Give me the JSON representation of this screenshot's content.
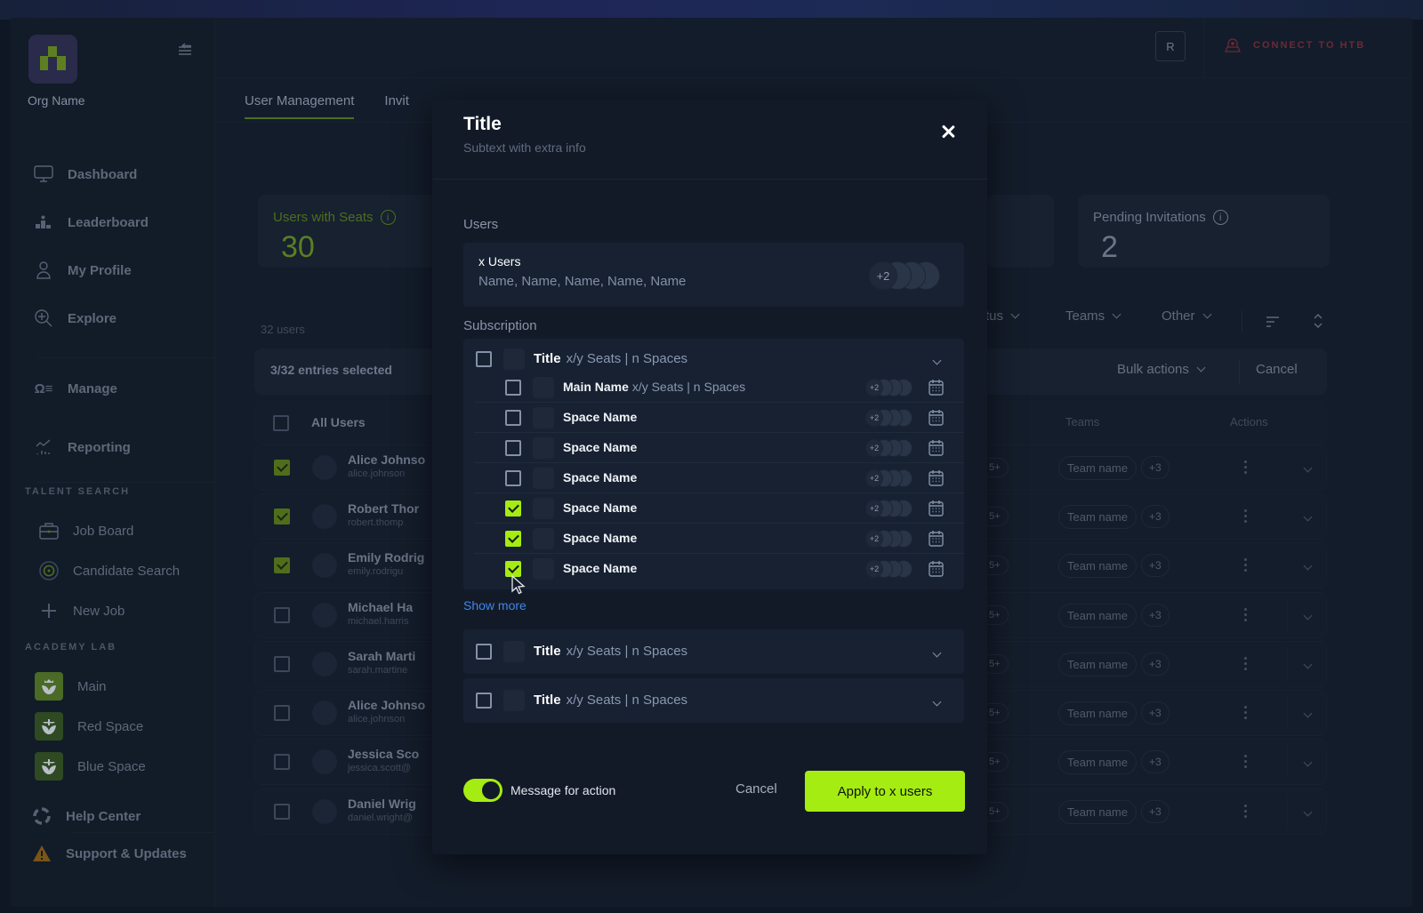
{
  "org": {
    "name": "Org Name"
  },
  "sidebar": {
    "items": [
      {
        "label": "Dashboard",
        "icon": "monitor-icon"
      },
      {
        "label": "Leaderboard",
        "icon": "podium-icon"
      },
      {
        "label": "My Profile",
        "icon": "user-icon"
      },
      {
        "label": "Explore",
        "icon": "explore-icon"
      },
      {
        "label": "Manage",
        "icon": "manage-icon"
      },
      {
        "label": "Reporting",
        "icon": "chart-icon"
      }
    ],
    "talent_section": "TALENT SEARCH",
    "talent_items": [
      {
        "label": "Job Board",
        "icon": "briefcase-icon"
      },
      {
        "label": "Candidate Search",
        "icon": "target-icon"
      },
      {
        "label": "New Job",
        "icon": "plus-icon"
      }
    ],
    "academy_section": "ACADEMY LAB",
    "academy_items": [
      {
        "label": "Main",
        "icon": "shield-crown-icon"
      },
      {
        "label": "Red Space",
        "icon": "shield-sword-icon"
      },
      {
        "label": "Blue Space",
        "icon": "shield-sword-icon"
      }
    ],
    "help": "Help Center",
    "support": "Support & Updates"
  },
  "header": {
    "avatar_initial": "R",
    "connect_label": "CONNECT TO HTB"
  },
  "tabs": [
    {
      "label": "User Management",
      "active": true
    },
    {
      "label": "Invit",
      "active": false
    }
  ],
  "stats": {
    "seats_label": "Users with Seats",
    "seats_value": "30",
    "pending_label": "Pending Invitations",
    "pending_value": "2"
  },
  "table": {
    "count_label": "32 users",
    "selected_label": "3/32 entries selected",
    "filters": [
      "status",
      "Teams",
      "Other"
    ],
    "bulk_actions": "Bulk actions",
    "cancel": "Cancel",
    "all_users": "All Users",
    "col_teams": "Teams",
    "col_actions": "Actions",
    "rows": [
      {
        "name": "Alice Johnso",
        "email": "alice.johnson",
        "checked": true,
        "badge": "5+",
        "team": "Team name",
        "more": "+3"
      },
      {
        "name": "Robert Thor",
        "email": "robert.thomp",
        "checked": true,
        "badge": "5+",
        "team": "Team name",
        "more": "+3"
      },
      {
        "name": "Emily Rodrig",
        "email": "emily.rodrigu",
        "checked": true,
        "badge": "5+",
        "team": "Team name",
        "more": "+3"
      },
      {
        "name": "Michael Ha",
        "email": "michael.harris",
        "checked": false,
        "badge": "5+",
        "team": "Team name",
        "more": "+3"
      },
      {
        "name": "Sarah Marti",
        "email": "sarah.martine",
        "checked": false,
        "badge": "5+",
        "team": "Team name",
        "more": "+3"
      },
      {
        "name": "Alice Johnso",
        "email": "alice.johnson",
        "checked": false,
        "badge": "5+",
        "team": "Team name",
        "more": "+3"
      },
      {
        "name": "Jessica Sco",
        "email": "jessica.scott@",
        "checked": false,
        "badge": "5+",
        "team": "Team name",
        "more": "+3"
      },
      {
        "name": "Daniel Wrig",
        "email": "daniel.wright@",
        "checked": false,
        "badge": "5+",
        "team": "Team name",
        "more": "+3"
      }
    ]
  },
  "modal": {
    "title": "Title",
    "subtitle": "Subtext with extra info",
    "users_label": "Users",
    "users_count": "x Users",
    "users_names": "Name, Name, Name, Name, Name",
    "users_more": "+2",
    "subscription_label": "Subscription",
    "groups": [
      {
        "title": "Title",
        "meta": "x/y Seats | n Spaces",
        "expanded": true,
        "checked": false,
        "spaces": [
          {
            "name": "Main Name",
            "meta": "x/y Seats | n Spaces",
            "checked": false,
            "more": "+2"
          },
          {
            "name": "Space Name",
            "meta": "",
            "checked": false,
            "more": "+2"
          },
          {
            "name": "Space Name",
            "meta": "",
            "checked": false,
            "more": "+2"
          },
          {
            "name": "Space Name",
            "meta": "",
            "checked": false,
            "more": "+2"
          },
          {
            "name": "Space Name",
            "meta": "",
            "checked": true,
            "more": "+2"
          },
          {
            "name": "Space Name",
            "meta": "",
            "checked": true,
            "more": "+2"
          },
          {
            "name": "Space Name",
            "meta": "",
            "checked": true,
            "more": "+2"
          }
        ]
      },
      {
        "title": "Title",
        "meta": "x/y Seats | n Spaces",
        "expanded": false,
        "checked": false
      },
      {
        "title": "Title",
        "meta": "x/y Seats | n Spaces",
        "expanded": false,
        "checked": false
      }
    ],
    "show_more": "Show more",
    "toggle_label": "Message for action",
    "toggle_on": true,
    "cancel": "Cancel",
    "apply": "Apply to x users"
  },
  "colors": {
    "accent": "#a5ec12",
    "link": "#3f86e8",
    "connect": "#6a2a36"
  }
}
